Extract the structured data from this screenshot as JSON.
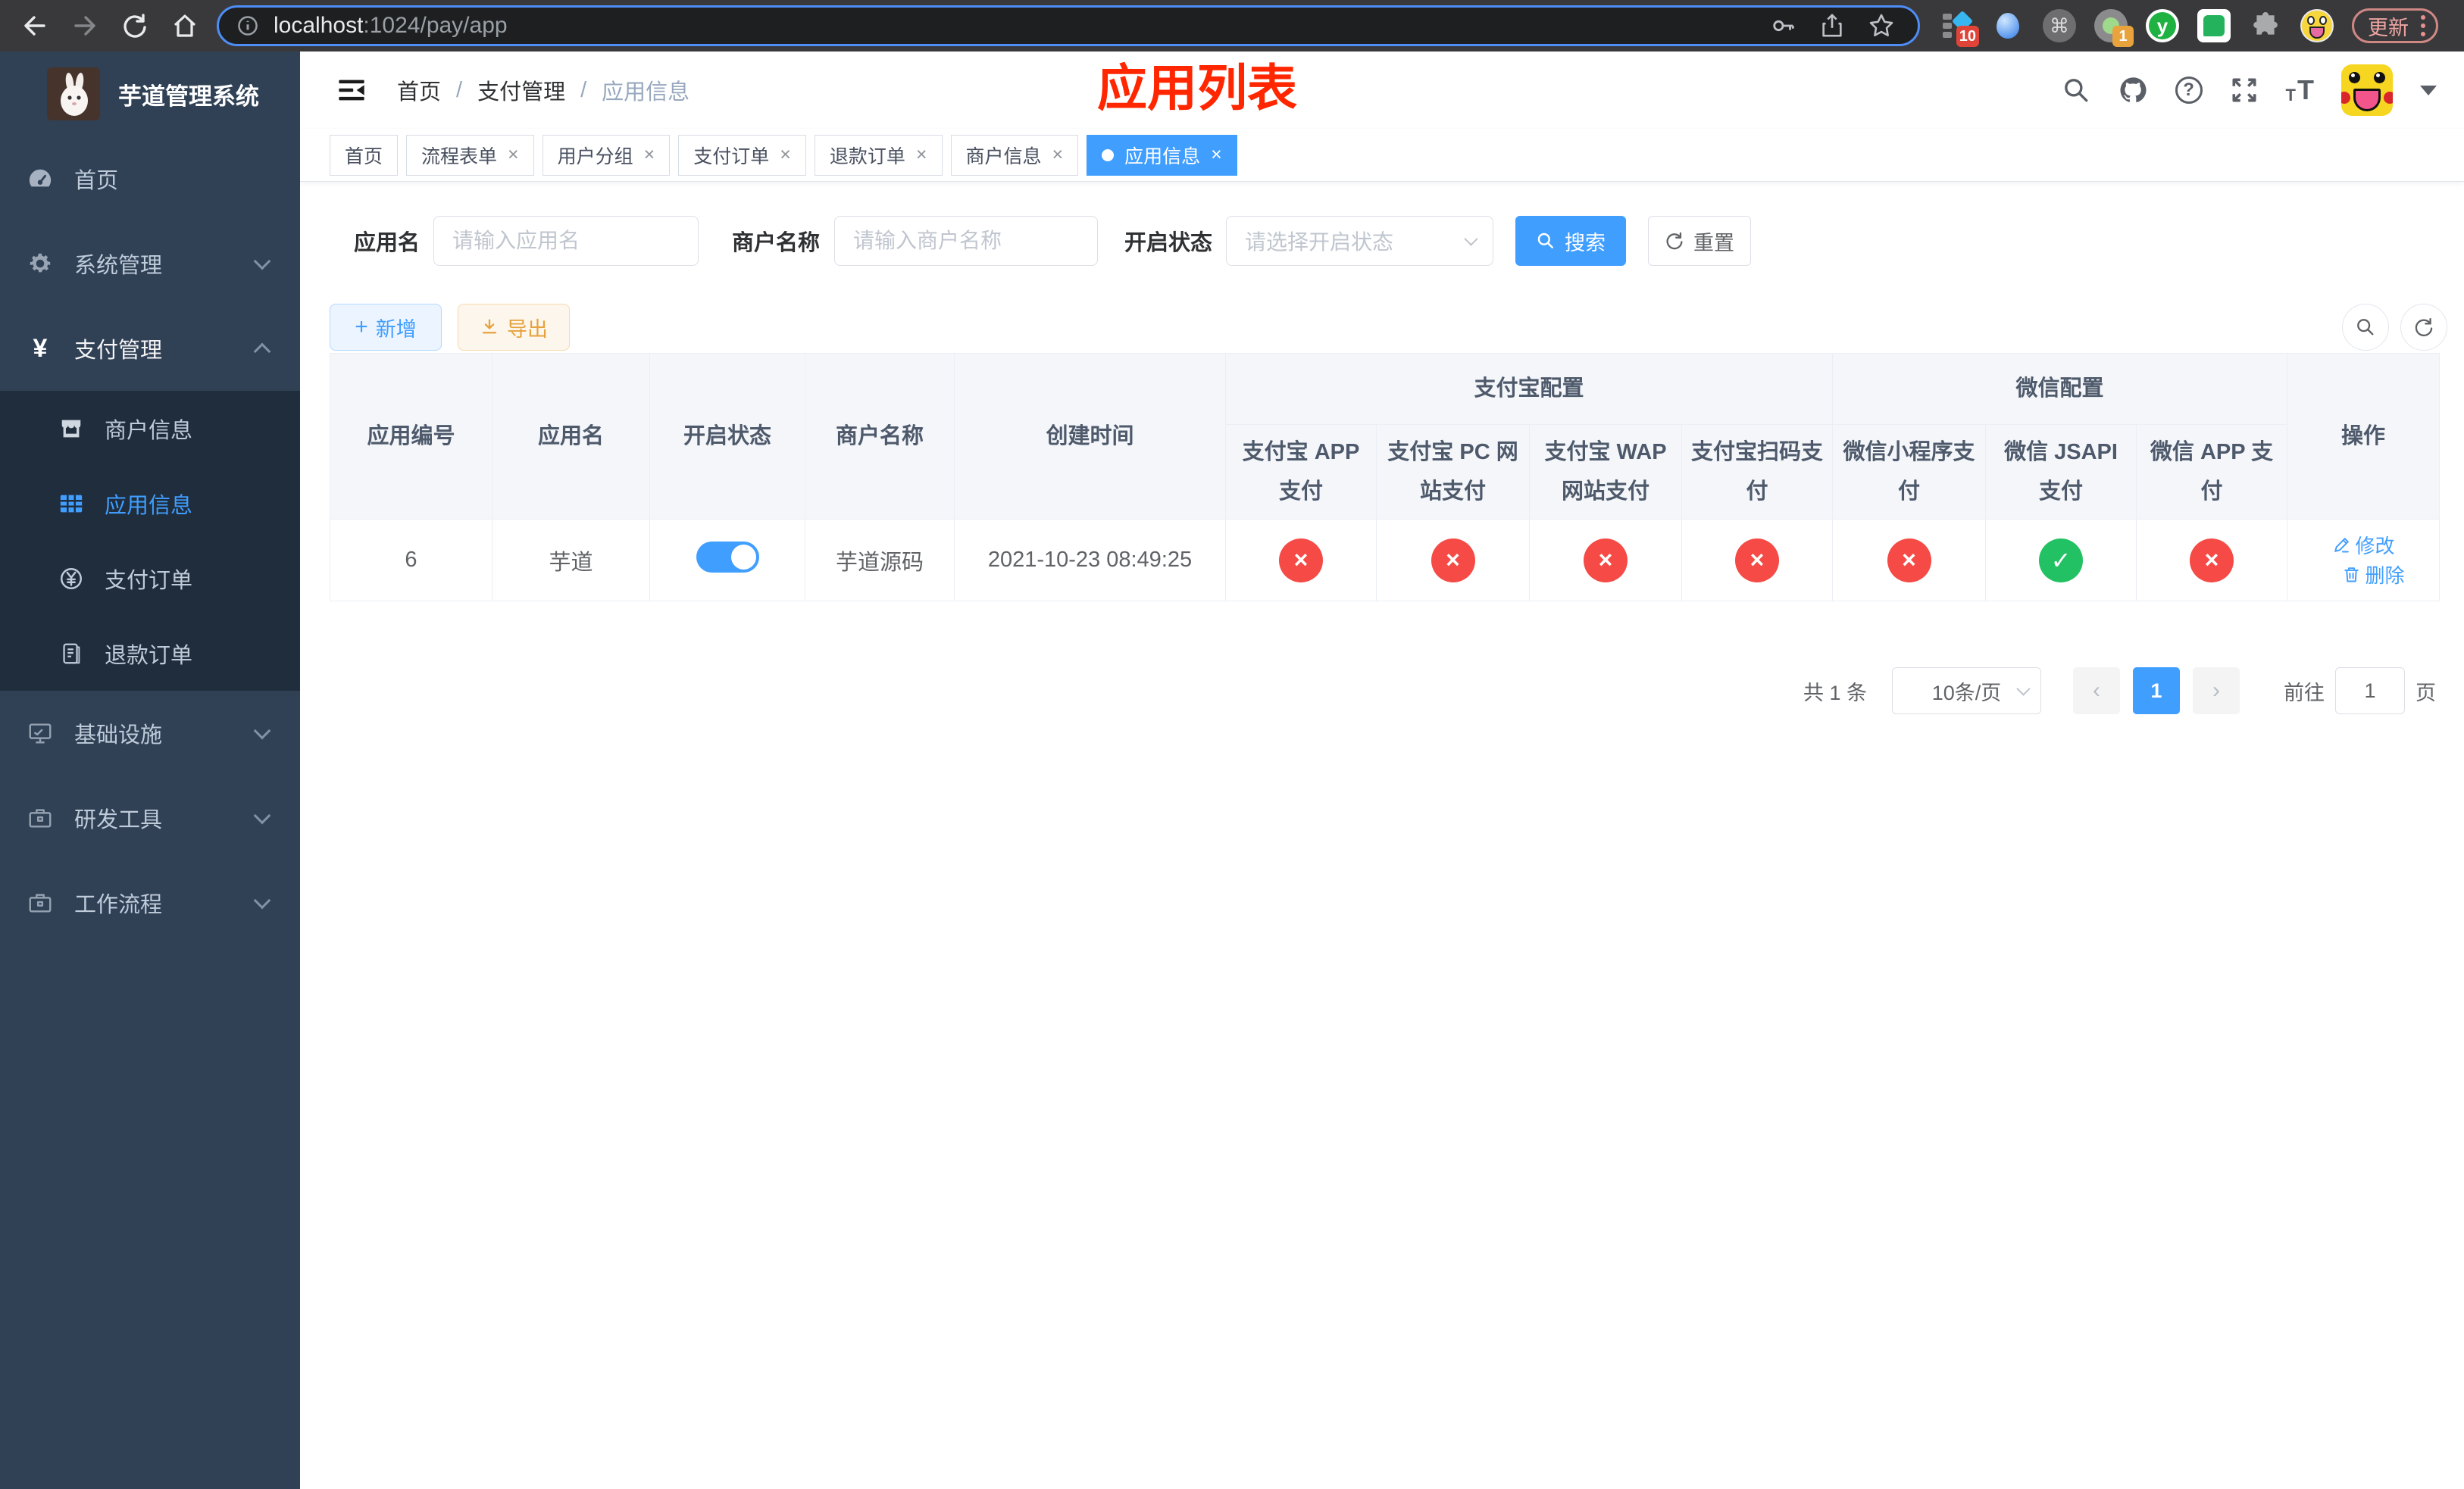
{
  "colors": {
    "accent": "#409eff",
    "danger": "#f54a45",
    "success": "#22c163",
    "sidebar_bg": "#304156",
    "submenu_bg": "#1f2d3d",
    "annotation": "#ff2600",
    "active_tab_bg": "#409eff"
  },
  "browser": {
    "url_host": "localhost",
    "url_rest": ":1024/pay/app",
    "ext_badge_blocks": "10",
    "ext_badge_rec": "1",
    "ext_y_letter": "y",
    "update_label": "更新"
  },
  "annotation": {
    "title": "应用列表"
  },
  "sidebar": {
    "logo_title": "芋道管理系统",
    "items": [
      {
        "label": "首页",
        "icon": "gauge-icon"
      },
      {
        "label": "系统管理",
        "icon": "gear-icon",
        "chevron": "down"
      },
      {
        "label": "支付管理",
        "icon": "yen-icon",
        "chevron": "up"
      },
      {
        "label": "基础设施",
        "icon": "monitor-icon",
        "chevron": "down"
      },
      {
        "label": "研发工具",
        "icon": "toolbox-icon",
        "chevron": "down"
      },
      {
        "label": "工作流程",
        "icon": "toolbox-icon",
        "chevron": "down"
      }
    ],
    "sub_items": [
      {
        "label": "商户信息",
        "icon": "shop-icon"
      },
      {
        "label": "应用信息",
        "icon": "grid-icon",
        "active": true
      },
      {
        "label": "支付订单",
        "icon": "yen-circle-icon"
      },
      {
        "label": "退款订单",
        "icon": "document-icon"
      }
    ]
  },
  "header": {
    "breadcrumb": [
      "首页",
      "支付管理",
      "应用信息"
    ]
  },
  "tabs": [
    {
      "label": "首页"
    },
    {
      "label": "流程表单"
    },
    {
      "label": "用户分组"
    },
    {
      "label": "支付订单"
    },
    {
      "label": "退款订单"
    },
    {
      "label": "商户信息"
    },
    {
      "label": "应用信息",
      "active": true
    }
  ],
  "filters": {
    "app_name_label": "应用名",
    "app_name_placeholder": "请输入应用名",
    "merchant_label": "商户名称",
    "merchant_placeholder": "请输入商户名称",
    "status_label": "开启状态",
    "status_placeholder": "请选择开启状态",
    "search_label": "搜索",
    "reset_label": "重置"
  },
  "toolbar": {
    "add_label": "新增",
    "export_label": "导出"
  },
  "table": {
    "columns": [
      "应用编号",
      "应用名",
      "开启状态",
      "商户名称",
      "创建时间"
    ],
    "group_alipay": "支付宝配置",
    "group_wechat": "微信配置",
    "alipay_columns": [
      "支付宝 APP 支付",
      "支付宝 PC 网站支付",
      "支付宝 WAP 网站支付",
      "支付宝扫码支付"
    ],
    "wechat_columns": [
      "微信小程序支付",
      "微信 JSAPI 支付",
      "微信 APP 支付"
    ],
    "actions_column": "操作",
    "row": {
      "id": "6",
      "name": "芋道",
      "merchant": "芋道源码",
      "created": "2021-10-23 08:49:25",
      "statuses": [
        "×",
        "×",
        "×",
        "×",
        "×",
        "✓",
        "×"
      ],
      "edit_label": "修改",
      "delete_label": "删除"
    }
  },
  "pagination": {
    "total": "共 1 条",
    "page_size": "10条/页",
    "current": "1",
    "goto_label": "前往",
    "goto_value": "1",
    "page_label": "页"
  }
}
